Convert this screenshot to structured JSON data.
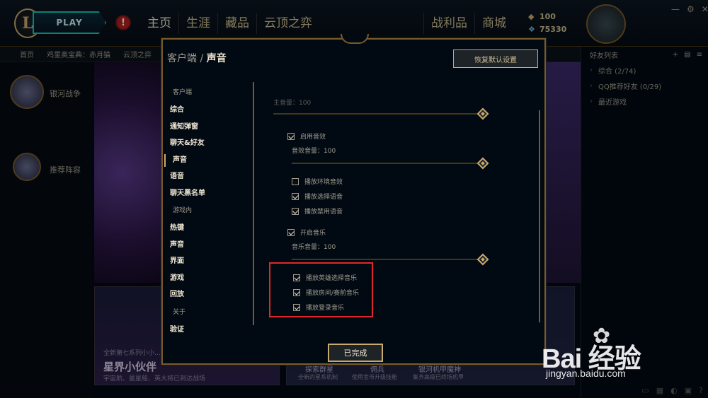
{
  "topbar": {
    "play": "PLAY",
    "alert": "!",
    "nav": [
      "主页",
      "生涯",
      "藏品",
      "云顶之弈"
    ],
    "nav_right": [
      "战利品",
      "商城"
    ],
    "currency": [
      {
        "icon": "gem-icon",
        "value": "100"
      },
      {
        "icon": "blue-essence-icon",
        "value": "75330"
      }
    ]
  },
  "subbar": [
    "首页",
    "鸡里奥宝典：赤月猫",
    "云顶之弈"
  ],
  "left": {
    "modes": [
      "银河战争",
      "推荐阵容"
    ]
  },
  "cards": {
    "left_small": "全新第七系列小小...",
    "left_title": "星界小伙伴",
    "left_sub": "宇宙航、星星船、英大将已到达战场",
    "right_items": [
      {
        "title": "探索群星",
        "sub": "全新的星系机制"
      },
      {
        "title": "佣兵",
        "sub": "使用金币升级技能"
      },
      {
        "title": "银河机甲魔神",
        "sub": "集齐高级已终场机甲"
      }
    ]
  },
  "friends": {
    "title": "好友列表",
    "groups": [
      "综合 (2/74)",
      "QQ推荐好友 (0/29)",
      "最近游戏"
    ]
  },
  "modal": {
    "breadcrumb_root": "客户端",
    "separator": "/",
    "breadcrumb_current": "声音",
    "restore_label": "恢复默认设置",
    "sections": [
      {
        "header": "客户端",
        "items": [
          "综合",
          "通知弹窗",
          "聊天&好友",
          "声音",
          "语音",
          "聊天黑名单"
        ]
      },
      {
        "header": "游戏内",
        "items": [
          "热键",
          "声音",
          "界面",
          "游戏",
          "回放"
        ]
      },
      {
        "header": "关于",
        "items": [
          "验证"
        ]
      }
    ],
    "active_item": "声音",
    "settings": {
      "master_label": "主音量：100",
      "master_value": 100,
      "sfx_enable": "启用音效",
      "sfx_enable_checked": true,
      "sfx_volume_label": "音效音量：100",
      "sfx_value": 100,
      "ambient": "播放环境音效",
      "ambient_checked": false,
      "pick_voice": "播放选择语音",
      "pick_voice_checked": true,
      "ban_voice": "播放禁用语音",
      "ban_voice_checked": true,
      "music_enable": "开启音乐",
      "music_enable_checked": true,
      "music_volume_label": "音乐音量：100",
      "music_value": 100,
      "champ_select_music": "播放英雄选择音乐",
      "champ_select_music_checked": true,
      "lobby_music": "播放房间/赛前音乐",
      "lobby_music_checked": true,
      "login_music": "播放登录音乐",
      "login_music_checked": true
    },
    "done_label": "已完成"
  },
  "watermark": {
    "logo": "Bai 经验",
    "url": "jingyan.baidu.com"
  },
  "colors": {
    "gold": "#c8aa6e",
    "dark_gold": "#785a28",
    "text": "#a09b8c",
    "highlight": "#e0282a",
    "teal": "#0ac8b9"
  }
}
